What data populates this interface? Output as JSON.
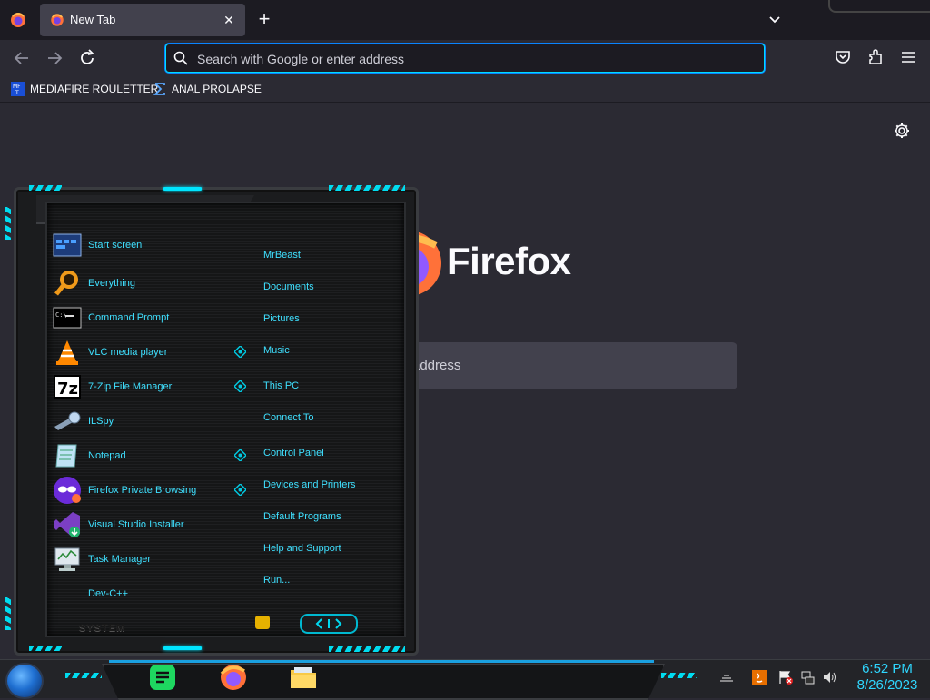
{
  "browser": {
    "tab_title": "New Tab",
    "url_placeholder": "Search with Google or enter address",
    "bookmarks": [
      "MEDIAFIRE ROULETTER",
      "ANAL PROLAPSE"
    ],
    "new_tab_search_placeholder": "address",
    "brand_name": "Firefox"
  },
  "start_menu": {
    "left_items": [
      {
        "label": "Start screen",
        "icon": "start-screen-icon"
      },
      {
        "label": "Everything",
        "icon": "magnifier-icon"
      },
      {
        "label": "Command Prompt",
        "icon": "terminal-icon"
      },
      {
        "label": "VLC media player",
        "icon": "vlc-cone-icon"
      },
      {
        "label": "7-Zip File Manager",
        "icon": "7zip-icon"
      },
      {
        "label": "ILSpy",
        "icon": "ilspy-icon"
      },
      {
        "label": "Notepad",
        "icon": "notepad-icon"
      },
      {
        "label": "Firefox Private Browsing",
        "icon": "private-browsing-icon"
      },
      {
        "label": "Visual Studio Installer",
        "icon": "vs-installer-icon"
      },
      {
        "label": "Task Manager",
        "icon": "task-manager-icon"
      },
      {
        "label": "Dev-C++",
        "icon": ""
      }
    ],
    "right_items": [
      "MrBeast",
      "Documents",
      "Pictures",
      "Music",
      "This PC",
      "Connect To",
      "Control Panel",
      "Devices and Printers",
      "Default Programs",
      "Help and Support",
      "Run..."
    ],
    "footer_label": "SYSTEM"
  },
  "taskbar": {
    "apps": [
      "notes-app-icon",
      "firefox-icon",
      "file-explorer-icon"
    ],
    "time": "6:52 PM",
    "date": "8/26/2023"
  },
  "colors": {
    "accent_cyan": "#00e5ff",
    "menu_text": "#3fe0ff",
    "browser_bg": "#2b2a33",
    "url_focus": "#00ddff"
  }
}
